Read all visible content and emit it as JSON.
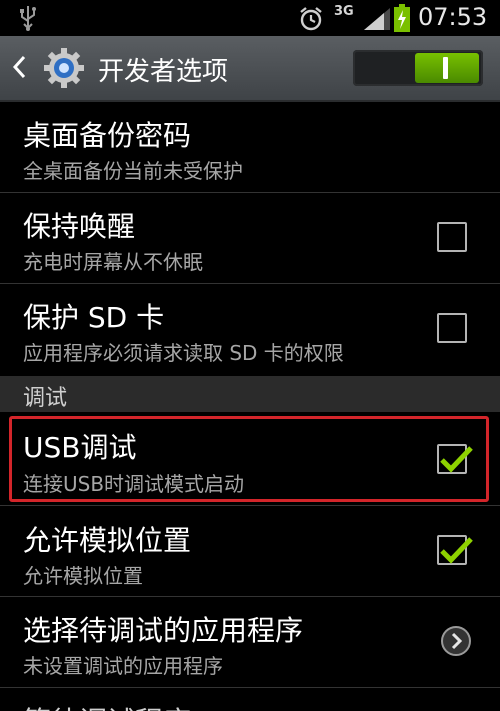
{
  "status_bar": {
    "network": "3G",
    "time": "07:53",
    "icons": [
      "usb-icon",
      "alarm-icon",
      "signal-icon",
      "battery-charging-icon"
    ]
  },
  "action_bar": {
    "title": "开发者选项",
    "master_toggle": {
      "state": "on",
      "label": "I"
    }
  },
  "items": [
    {
      "title": "桌面备份密码",
      "summary": "全桌面备份当前未受保护",
      "control": "none"
    },
    {
      "title": "保持唤醒",
      "summary": "充电时屏幕从不休眠",
      "control": "checkbox",
      "checked": false
    },
    {
      "title": "保护 SD 卡",
      "summary": "应用程序必须请求读取 SD 卡的权限",
      "control": "checkbox",
      "checked": false
    }
  ],
  "section": {
    "label": "调试"
  },
  "debug_items": [
    {
      "title": "USB调试",
      "summary": "连接USB时调试模式启动",
      "control": "checkbox",
      "checked": true
    },
    {
      "title": "允许模拟位置",
      "summary": "允许模拟位置",
      "control": "checkbox",
      "checked": true
    },
    {
      "title": "选择待调试的应用程序",
      "summary": "未设置调试的应用程序",
      "control": "chevron"
    },
    {
      "title": "等待调试程序",
      "summary": "",
      "control": "none"
    }
  ],
  "colors": {
    "accent_green": "#78c000",
    "highlight_red": "#d3252a",
    "check_green": "#8ed200"
  }
}
